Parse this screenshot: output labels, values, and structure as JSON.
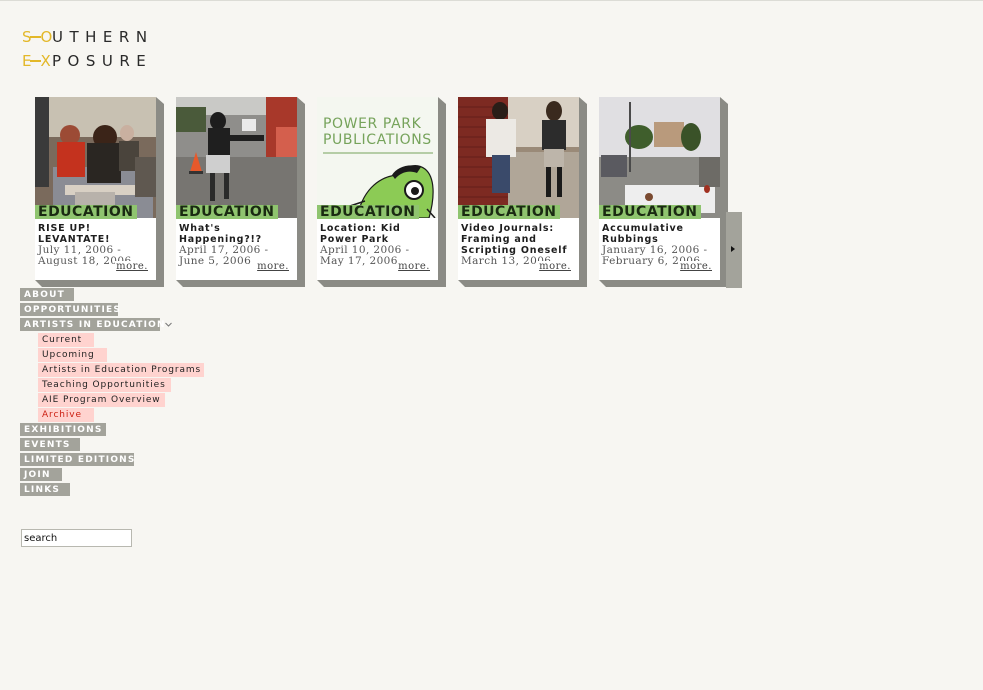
{
  "logo": {
    "mark_top": "S",
    "mark_top2": "O",
    "word_top": "UTHERN",
    "mark_bottom": "E",
    "mark_bottom2": "X",
    "word_bottom": "POSURE",
    "brand_color": "#e3b829"
  },
  "carousel": {
    "cards": [
      {
        "category": "EDUCATION",
        "title": "RISE UP! LEVANTATE!",
        "date": "July 11, 2006 - August 18, 2006",
        "more": "more.",
        "image": "community-art-workshop-photo"
      },
      {
        "category": "EDUCATION",
        "title": "What's Happening?!?",
        "date": "April 17, 2006 - June 5, 2006",
        "more": "more.",
        "image": "student-street-photo"
      },
      {
        "category": "EDUCATION",
        "title": "Location: Kid Power Park",
        "date": "April 10, 2006 - May 17, 2006",
        "more": "more.",
        "image": "power-park-publications-graphic",
        "image_text_1": "POWER PARK",
        "image_text_2": "PUBLICATIONS"
      },
      {
        "category": "EDUCATION",
        "title": "Video Journals: Framing and Scripting Oneself",
        "date": "March 13, 2006",
        "more": "more.",
        "image": "students-with-camera-photo"
      },
      {
        "category": "EDUCATION",
        "title": "Accumulative Rubbings",
        "date": "January 16, 2006 - February 6, 2006",
        "more": "more.",
        "image": "street-rubbings-photo"
      }
    ],
    "next_icon": "triangle-right-icon"
  },
  "nav": {
    "items": [
      {
        "label": "ABOUT"
      },
      {
        "label": "OPPORTUNITIES"
      },
      {
        "label": "ARTISTS IN EDUCATION",
        "expanded": true
      }
    ],
    "sub_items": [
      {
        "label": "Current"
      },
      {
        "label": "Upcoming"
      },
      {
        "label": "Artists in Education Programs"
      },
      {
        "label": "Teaching Opportunities"
      },
      {
        "label": "AIE Program Overview"
      },
      {
        "label": "Archive",
        "active": true
      }
    ],
    "items_after": [
      {
        "label": "EXHIBITIONS"
      },
      {
        "label": "EVENTS"
      },
      {
        "label": "LIMITED EDITIONS"
      },
      {
        "label": "JOIN"
      },
      {
        "label": "LINKS"
      }
    ],
    "colors": {
      "nav_bg": "#a3a39b",
      "sub_bg": "#ffd3cf",
      "active": "#cc1f12"
    }
  },
  "search": {
    "value": "search"
  },
  "colors": {
    "category_green": "#8fc46f",
    "page_bg": "#f7f6f2"
  }
}
